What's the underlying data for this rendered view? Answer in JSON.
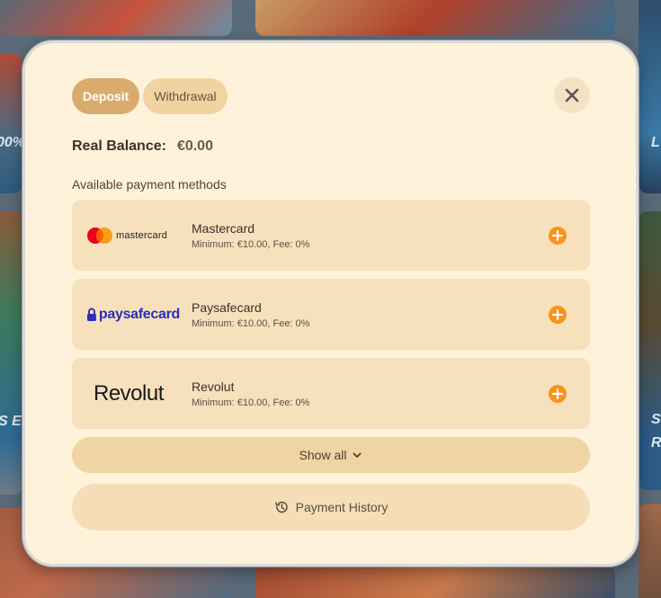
{
  "tabs": [
    {
      "label": "Deposit",
      "active": true
    },
    {
      "label": "Withdrawal",
      "active": false
    }
  ],
  "balance": {
    "label": "Real Balance:",
    "amount": "€0.00"
  },
  "methods_label": "Available payment methods",
  "methods": [
    {
      "name": "Mastercard",
      "info": "Minimum: €10.00, Fee: 0%",
      "logo_text": "mastercard"
    },
    {
      "name": "Paysafecard",
      "info": "Minimum: €10.00, Fee: 0%",
      "logo_text": "paysafecard"
    },
    {
      "name": "Revolut",
      "info": "Minimum: €10.00, Fee: 0%",
      "logo_text": "Revolut"
    }
  ],
  "show_all_label": "Show all",
  "history_label": "Payment History",
  "background_text": [
    "00%",
    "S E",
    "L",
    "S",
    "R"
  ],
  "colors": {
    "modal_bg": "#fff2db",
    "tab_active": "#d9ab6c",
    "accent_orange": "#f7941d",
    "method_bg": "#f7e1bd"
  },
  "icons": {
    "close": "close-icon",
    "add": "plus-circle-icon",
    "chevron": "chevron-down-icon",
    "history": "history-icon"
  }
}
